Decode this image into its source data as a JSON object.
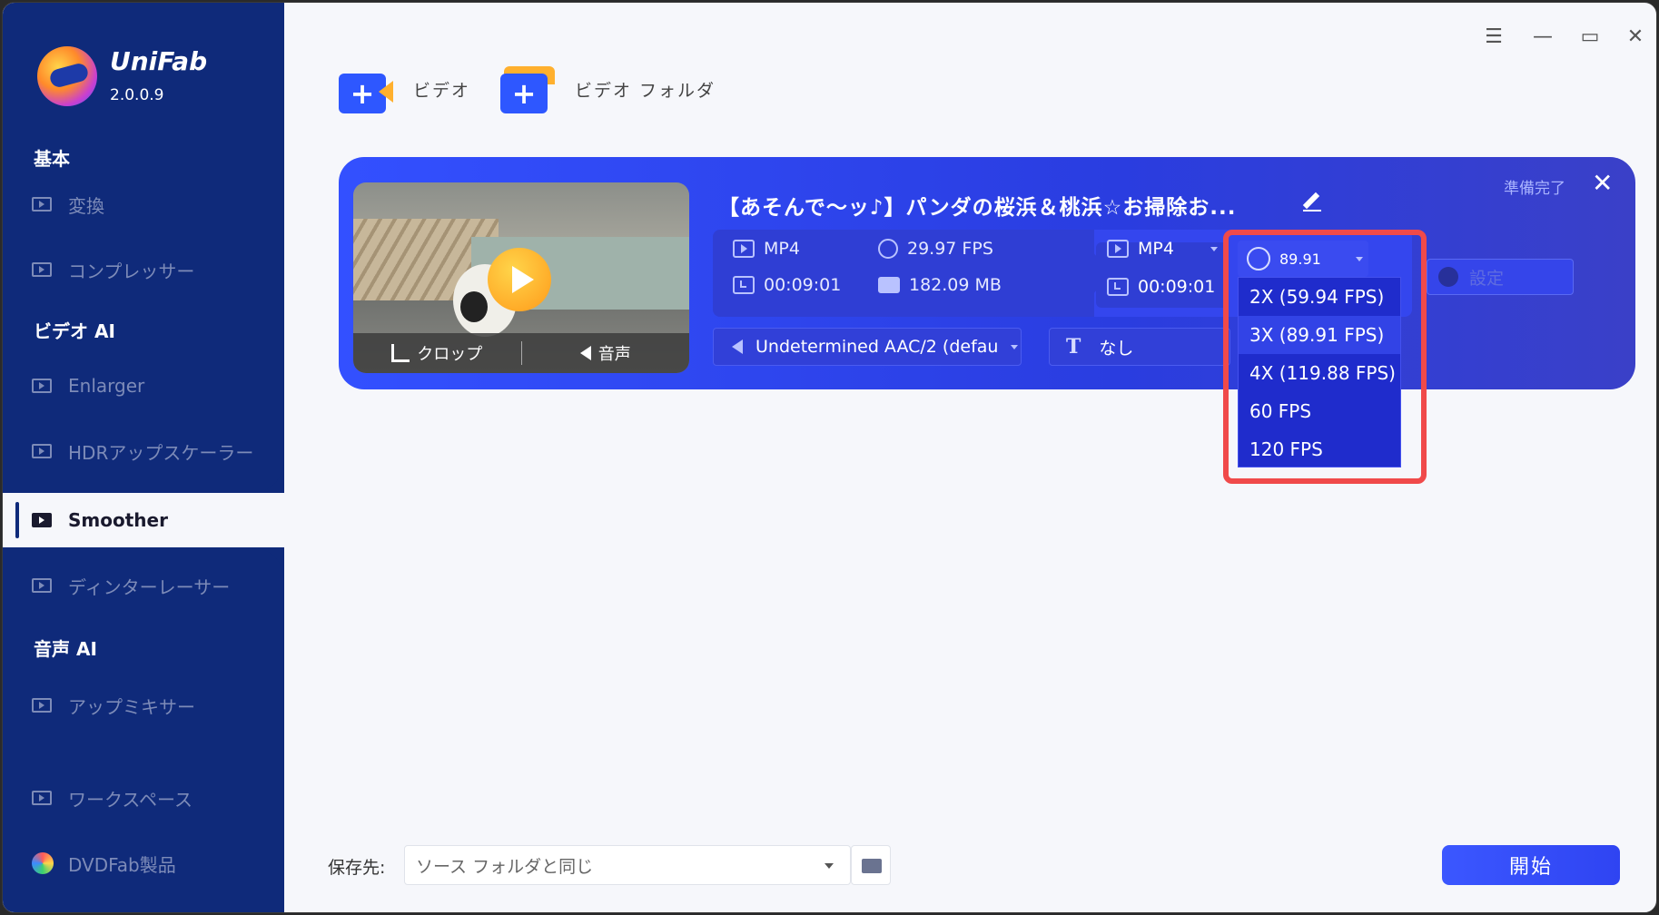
{
  "app": {
    "name": "UniFab",
    "version": "2.0.0.9"
  },
  "sidebar": {
    "sections": [
      {
        "label": "基本"
      },
      {
        "label": "ビデオ AI"
      },
      {
        "label": "音声 AI"
      }
    ],
    "items": [
      {
        "label": "変換",
        "icon": "play-box-icon"
      },
      {
        "label": "コンプレッサー",
        "icon": "compress-icon"
      },
      {
        "label": "Enlarger",
        "icon": "enlarge-icon"
      },
      {
        "label": "HDRアップスケーラー",
        "icon": "hdr-icon"
      },
      {
        "label": "Smoother",
        "icon": "monitor-icon",
        "active": true
      },
      {
        "label": "ディンターレーサー",
        "icon": "deinterlace-icon"
      },
      {
        "label": "アップミキサー",
        "icon": "mixer-icon"
      },
      {
        "label": "ワークスペース",
        "icon": "monitor-icon"
      },
      {
        "label": "DVDFab製品",
        "icon": "dvdfab-icon"
      }
    ]
  },
  "toolbar": {
    "add_video": "ビデオ",
    "add_folder": "ビデオ フォルダ"
  },
  "task": {
    "title": "【あそんで～ッ♪】パンダの桜浜＆桃浜☆お掃除お...",
    "status": "準備完了",
    "thumb_crop": "クロップ",
    "thumb_audio": "音声",
    "source": {
      "format": "MP4",
      "fps": "29.97 FPS",
      "duration": "00:09:01",
      "size": "182.09 MB"
    },
    "output": {
      "format": "MP4",
      "duration": "00:09:01"
    },
    "audio_track": "Undetermined AAC/2 (defau",
    "subtitle": "なし",
    "settings_label": "設定",
    "fps_selected": "89.91",
    "fps_options": [
      {
        "label": "2X (59.94 FPS)"
      },
      {
        "label": "3X (89.91 FPS)",
        "highlight": true
      },
      {
        "label": "4X (119.88 FPS)"
      },
      {
        "label": "60 FPS"
      },
      {
        "label": "120 FPS"
      }
    ]
  },
  "bottom": {
    "save_label": "保存先:",
    "save_value": "ソース フォルダと同じ",
    "start_label": "開始"
  },
  "colors": {
    "sidebar": "#0f2a7a",
    "card": "#3350ff",
    "accent": "#2e57ff",
    "highlight_box": "#f04a4a"
  }
}
